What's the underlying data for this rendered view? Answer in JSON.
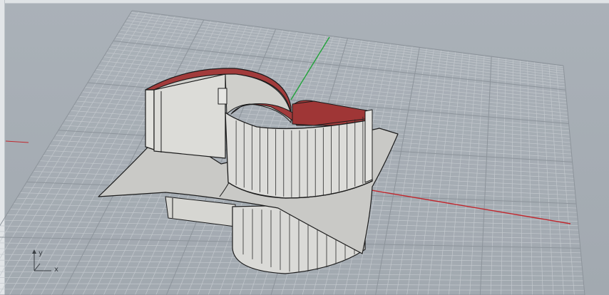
{
  "viewport": {
    "background": "#a7aeb5",
    "grid_minor_color": "#c3c8cd",
    "grid_major_color": "#8d949b",
    "x_axis_color": "#c1272d",
    "y_axis_color": "#21a33a",
    "display_mode": "shaded"
  },
  "model": {
    "surface_color": "#d9d9d6",
    "inner_wall_color": "#c4c4c0",
    "interior_color": "#a23b3b",
    "edge_color": "#1b1b1b"
  },
  "axis_widget": {
    "x_label": "x",
    "y_label": "y",
    "z_icon": "z-axis-arrow-icon"
  }
}
